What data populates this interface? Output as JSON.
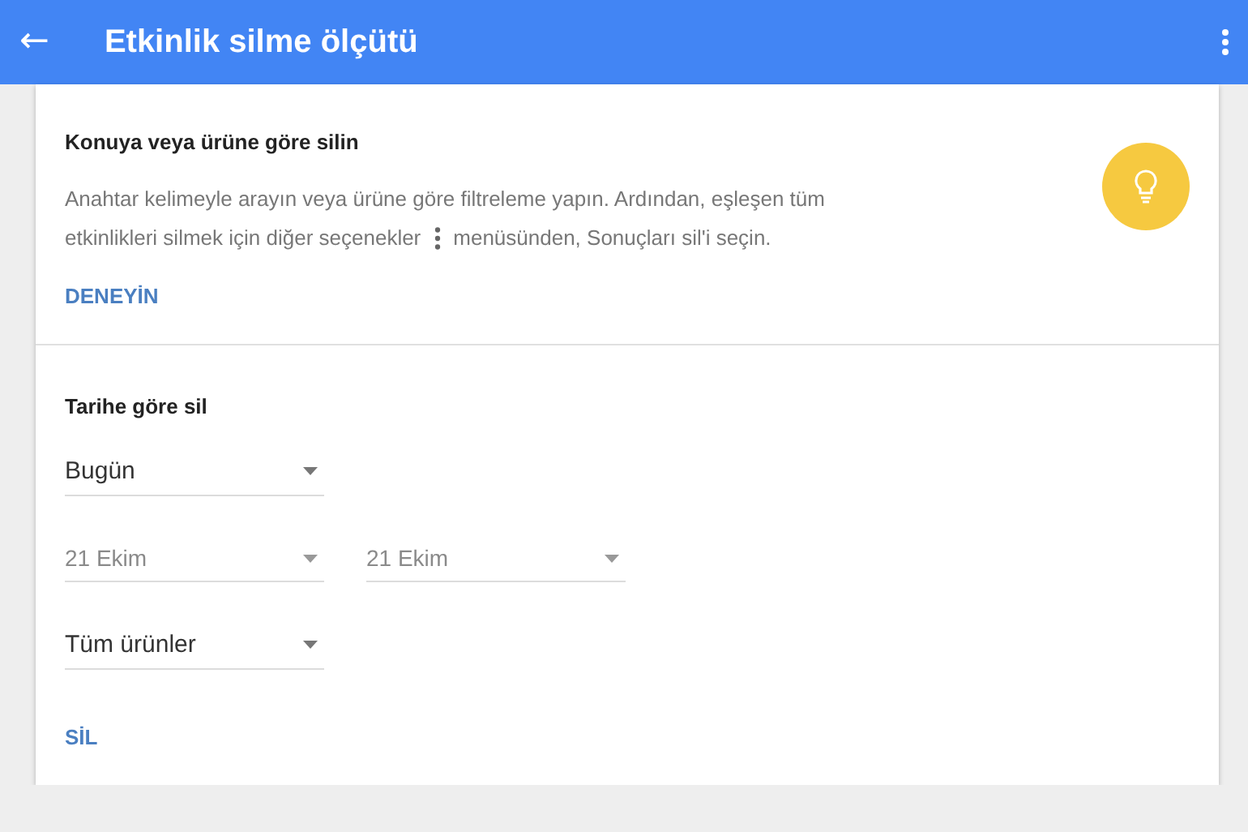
{
  "app_bar": {
    "back_icon": "←",
    "title": "Etkinlik silme ölçütü"
  },
  "topic_section": {
    "title": "Konuya veya ürüne göre silin",
    "description_line_1": "Anahtar kelimeyle arayın veya ürüne göre filtreleme yapın. Ardından, eşleşen tüm",
    "description_line_2_before": "etkinlikleri silmek için diğer seçenekler",
    "description_line_2_after": "menüsünden, Sonuçları sil'i seçin.",
    "action": "DENEYİN"
  },
  "date_section": {
    "title": "Tarihe göre sil",
    "rows": [
      {
        "dropdowns": [
          {
            "value": "Bugün",
            "disabled": false
          }
        ]
      },
      {
        "dropdowns": [
          {
            "value": "21 Ekim",
            "disabled": true
          },
          {
            "value": "21 Ekim",
            "disabled": true
          }
        ]
      },
      {
        "dropdowns": [
          {
            "value": "Tüm ürünler",
            "disabled": false
          }
        ]
      }
    ],
    "action": "SİL"
  }
}
